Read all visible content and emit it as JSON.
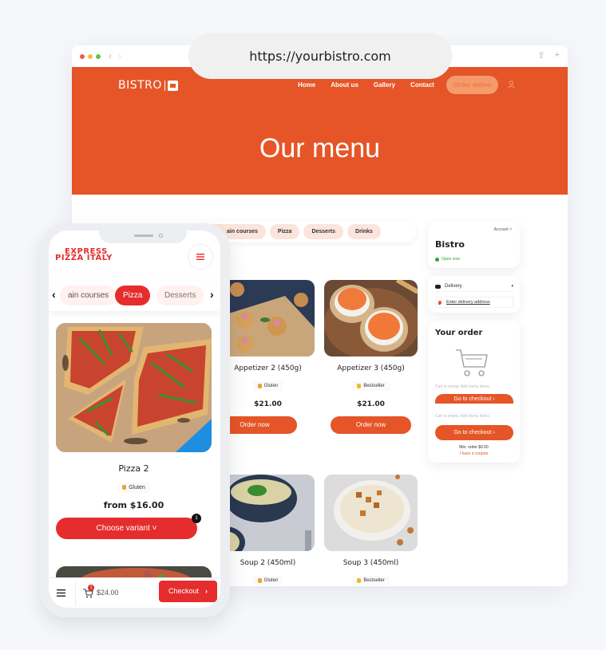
{
  "browser": {
    "url": "https://yourbistro.com",
    "traffic_lights": [
      "#ee5a52",
      "#f5bd3f",
      "#5fc548"
    ],
    "back_label": "‹",
    "forward_label": "›",
    "share_icon": "⇧",
    "new_tab_icon": "+"
  },
  "site": {
    "logo_text": "BISTRO",
    "nav": [
      "Home",
      "About us",
      "Gallery",
      "Contact"
    ],
    "order_online": "Order online",
    "hero_title": "Our menu",
    "brand_color": "#e55527",
    "categories": [
      "ain courses",
      "Pizza",
      "Desserts",
      "Drinks"
    ],
    "products": [
      {
        "title": "Appetizer 2 (450g)",
        "badge": "Gluten",
        "price": "$21.00",
        "button": "Order now"
      },
      {
        "title": "Appetizer 3 (450g)",
        "badge": "Bestseller",
        "price": "$21.00",
        "button": "Order now"
      },
      {
        "title": "Soup 2 (450ml)",
        "badge": "Gluten"
      },
      {
        "title": "Soup 3 (450ml)",
        "badge": "Bestseller"
      }
    ],
    "restaurant": {
      "account_label": "Account ˅",
      "name": "Bistro",
      "status": "Open now"
    },
    "delivery": {
      "mode": "Delivery",
      "address_link": "Enter delivery address"
    },
    "order": {
      "title": "Your order",
      "empty_text": "Cart is empty. Add menu items.",
      "checkout": "Go to checkout ›",
      "min_order": "Min. order $0.00",
      "coupon": "I have a coupon"
    }
  },
  "phone": {
    "logo_line1": "EXPRESS",
    "logo_line2": "PIZZA ITALY",
    "categories": [
      "ain courses",
      "Pizza",
      "Desserts"
    ],
    "active_category": "Pizza",
    "prev_arrow": "‹",
    "next_arrow": "›",
    "product": {
      "title": "Pizza 2",
      "badge": "Gluten",
      "price": "from $16.00",
      "button": "Choose variant ˅",
      "notification_count": "1"
    },
    "cart": {
      "count": "1",
      "total": "$24.00",
      "checkout": "Checkout"
    },
    "accent_color": "#e52d2d"
  }
}
